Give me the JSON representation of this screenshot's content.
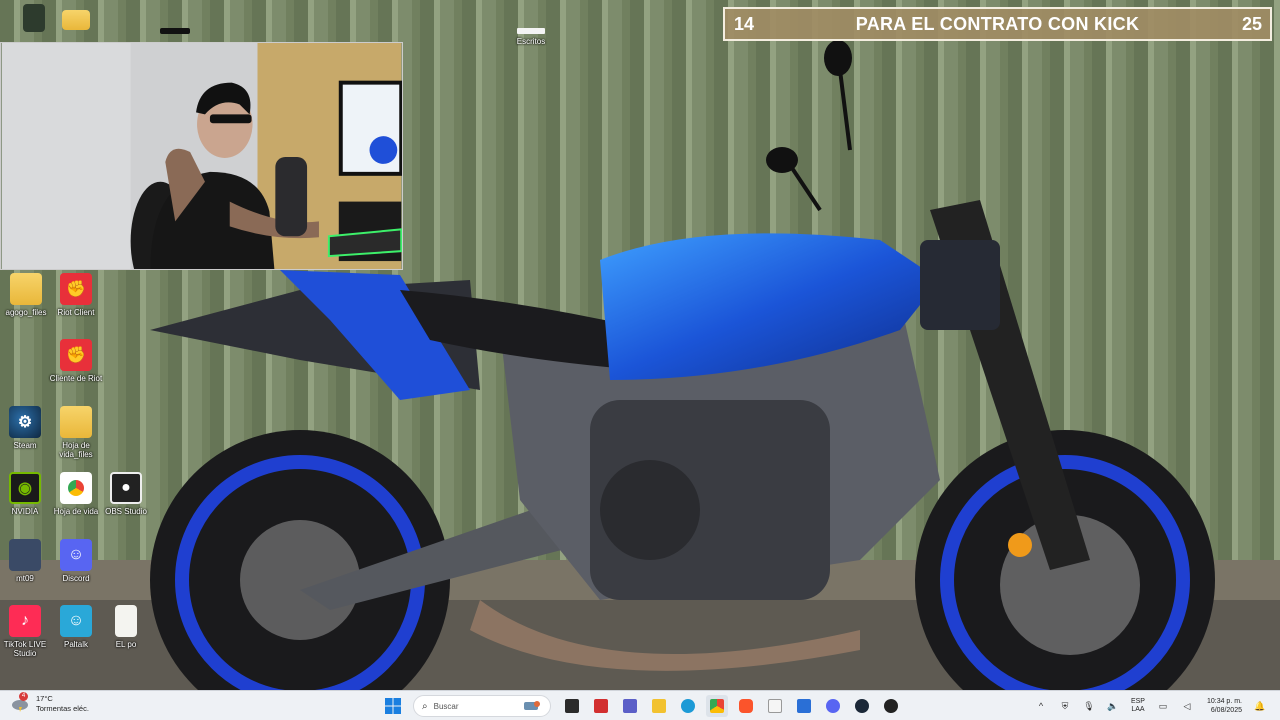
{
  "goal_banner": {
    "current": "14",
    "text": "PARA EL CONTRATO CON KICK",
    "target": "25"
  },
  "desktop": {
    "top_labels": [
      "Escritos"
    ],
    "icons": [
      {
        "label": "agogo_files",
        "icon": "folder-icon"
      },
      {
        "label": "Riot Client",
        "icon": "riot-icon"
      },
      {
        "label": "Cliente de Riot",
        "icon": "riot-icon"
      },
      {
        "label": "Steam",
        "icon": "steam-icon"
      },
      {
        "label": "Hoja de vida_files",
        "icon": "folder-icon"
      },
      {
        "label": "NVIDIA",
        "icon": "nvidia-icon"
      },
      {
        "label": "Hoja de vida",
        "icon": "chrome-icon"
      },
      {
        "label": "OBS Studio",
        "icon": "obs-icon"
      },
      {
        "label": "mt09",
        "icon": "image-icon"
      },
      {
        "label": "Discord",
        "icon": "discord-icon"
      },
      {
        "label": "TikTok LIVE Studio",
        "icon": "tiktok-icon"
      },
      {
        "label": "Paltalk",
        "icon": "paltalk-icon"
      },
      {
        "label": "EL po",
        "icon": "document-icon"
      }
    ]
  },
  "taskbar": {
    "weather": {
      "temp": "17°C",
      "desc": "Tormentas eléc.",
      "badge": "4"
    },
    "search_placeholder": "Buscar",
    "language": [
      "ESP",
      "LAA"
    ],
    "time": "10:34 p. m.",
    "date": "6/08/2025"
  },
  "colors": {
    "banner_bg": "#a08c64",
    "taskbar_bg": "#eef1f5",
    "accent_blue": "#1f4fd8"
  }
}
